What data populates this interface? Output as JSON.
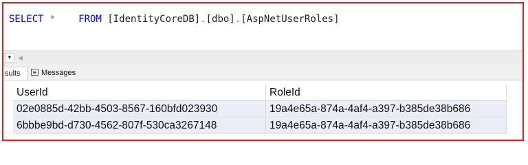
{
  "editor": {
    "select_kw": "SELECT",
    "star": "*",
    "from_kw": "FROM",
    "db": "[IdentityCoreDB]",
    "dot1": ".",
    "schema": "[dbo]",
    "dot2": ".",
    "table": "[AspNetUserRoles]"
  },
  "tabs": {
    "results_label": "sults",
    "messages_label": "Messages"
  },
  "icons": {
    "dropdown": "chevron-down-icon",
    "scroll_left": "arrow-left-icon",
    "messages": "messages-icon"
  },
  "grid": {
    "columns": [
      "UserId",
      "RoleId"
    ],
    "rows": [
      [
        "02e0885d-42bb-4503-8567-160bfd023930",
        "19a4e65a-874a-4af4-a397-b385de38b686"
      ],
      [
        "6bbbe9bd-d730-4562-807f-530ca3267148",
        "19a4e65a-874a-4af4-a397-b385de38b686"
      ]
    ]
  },
  "colors": {
    "frame_border": "#e51c23",
    "keyword": "#0000ff",
    "row_bg": "#e9eef6"
  }
}
